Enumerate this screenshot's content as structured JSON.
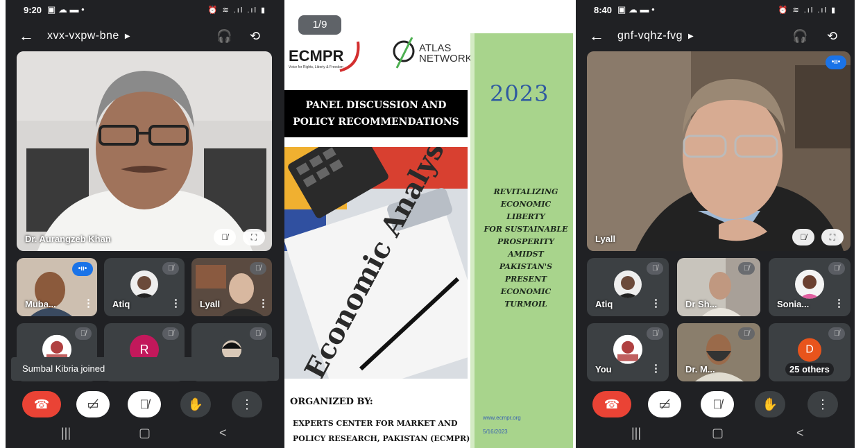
{
  "left_call": {
    "status_time": "9:20",
    "meeting_code": "xvx-vxpw-bne",
    "main_speaker": "Dr. Aurangzeb Khan",
    "tiles": [
      {
        "name": "Muba..."
      },
      {
        "name": "Atiq"
      },
      {
        "name": "Lyall"
      },
      {
        "name": ""
      },
      {
        "name": "",
        "avatar_letter": "R"
      },
      {
        "name": ""
      }
    ],
    "toast": "Sumbal Kibria joined"
  },
  "document": {
    "page_counter": "1/9",
    "org_logo": "ECMPR",
    "org_tagline": "Voice for Rights, Liberty & Freedom",
    "partner_logo": "ATLAS\nNETWORK",
    "title_box": "PANEL DISCUSSION AND\nPOLICY RECOMMENDATIONS",
    "year": "2023",
    "subtitle": "REVITALIZING\nECONOMIC LIBERTY\nFOR SUSTAINABLE\nPROSPERITY AMIDST\nPAKISTAN'S PRESENT\nECONOMIC TURMOIL",
    "image_text": "Economic Analysis",
    "organized_by_label": "ORGANIZED BY:",
    "organizer": "EXPERTS CENTER FOR MARKET AND\nPOLICY RESEARCH, PAKISTAN (ECMPR)",
    "website": "www.ecmpr.org",
    "date": "5/16/2023"
  },
  "right_call": {
    "status_time": "8:40",
    "meeting_code": "gnf-vqhz-fvg",
    "main_speaker": "Lyall",
    "tiles": [
      {
        "name": "Atiq"
      },
      {
        "name": "Dr Sh..."
      },
      {
        "name": "Sonia..."
      },
      {
        "name": "You"
      },
      {
        "name": "Dr. M..."
      },
      {
        "name": "25 others",
        "avatar_letter": "D"
      }
    ]
  },
  "colors": {
    "end_call": "#ea4335",
    "speaking": "#1a73e8",
    "meet_bg": "#202124"
  },
  "icons": [
    "back-arrow-icon",
    "headphones-icon",
    "camera-flip-icon",
    "mic-off-icon",
    "fullscreen-icon",
    "end-call-icon",
    "camera-off-icon",
    "raise-hand-icon",
    "more-icon"
  ]
}
